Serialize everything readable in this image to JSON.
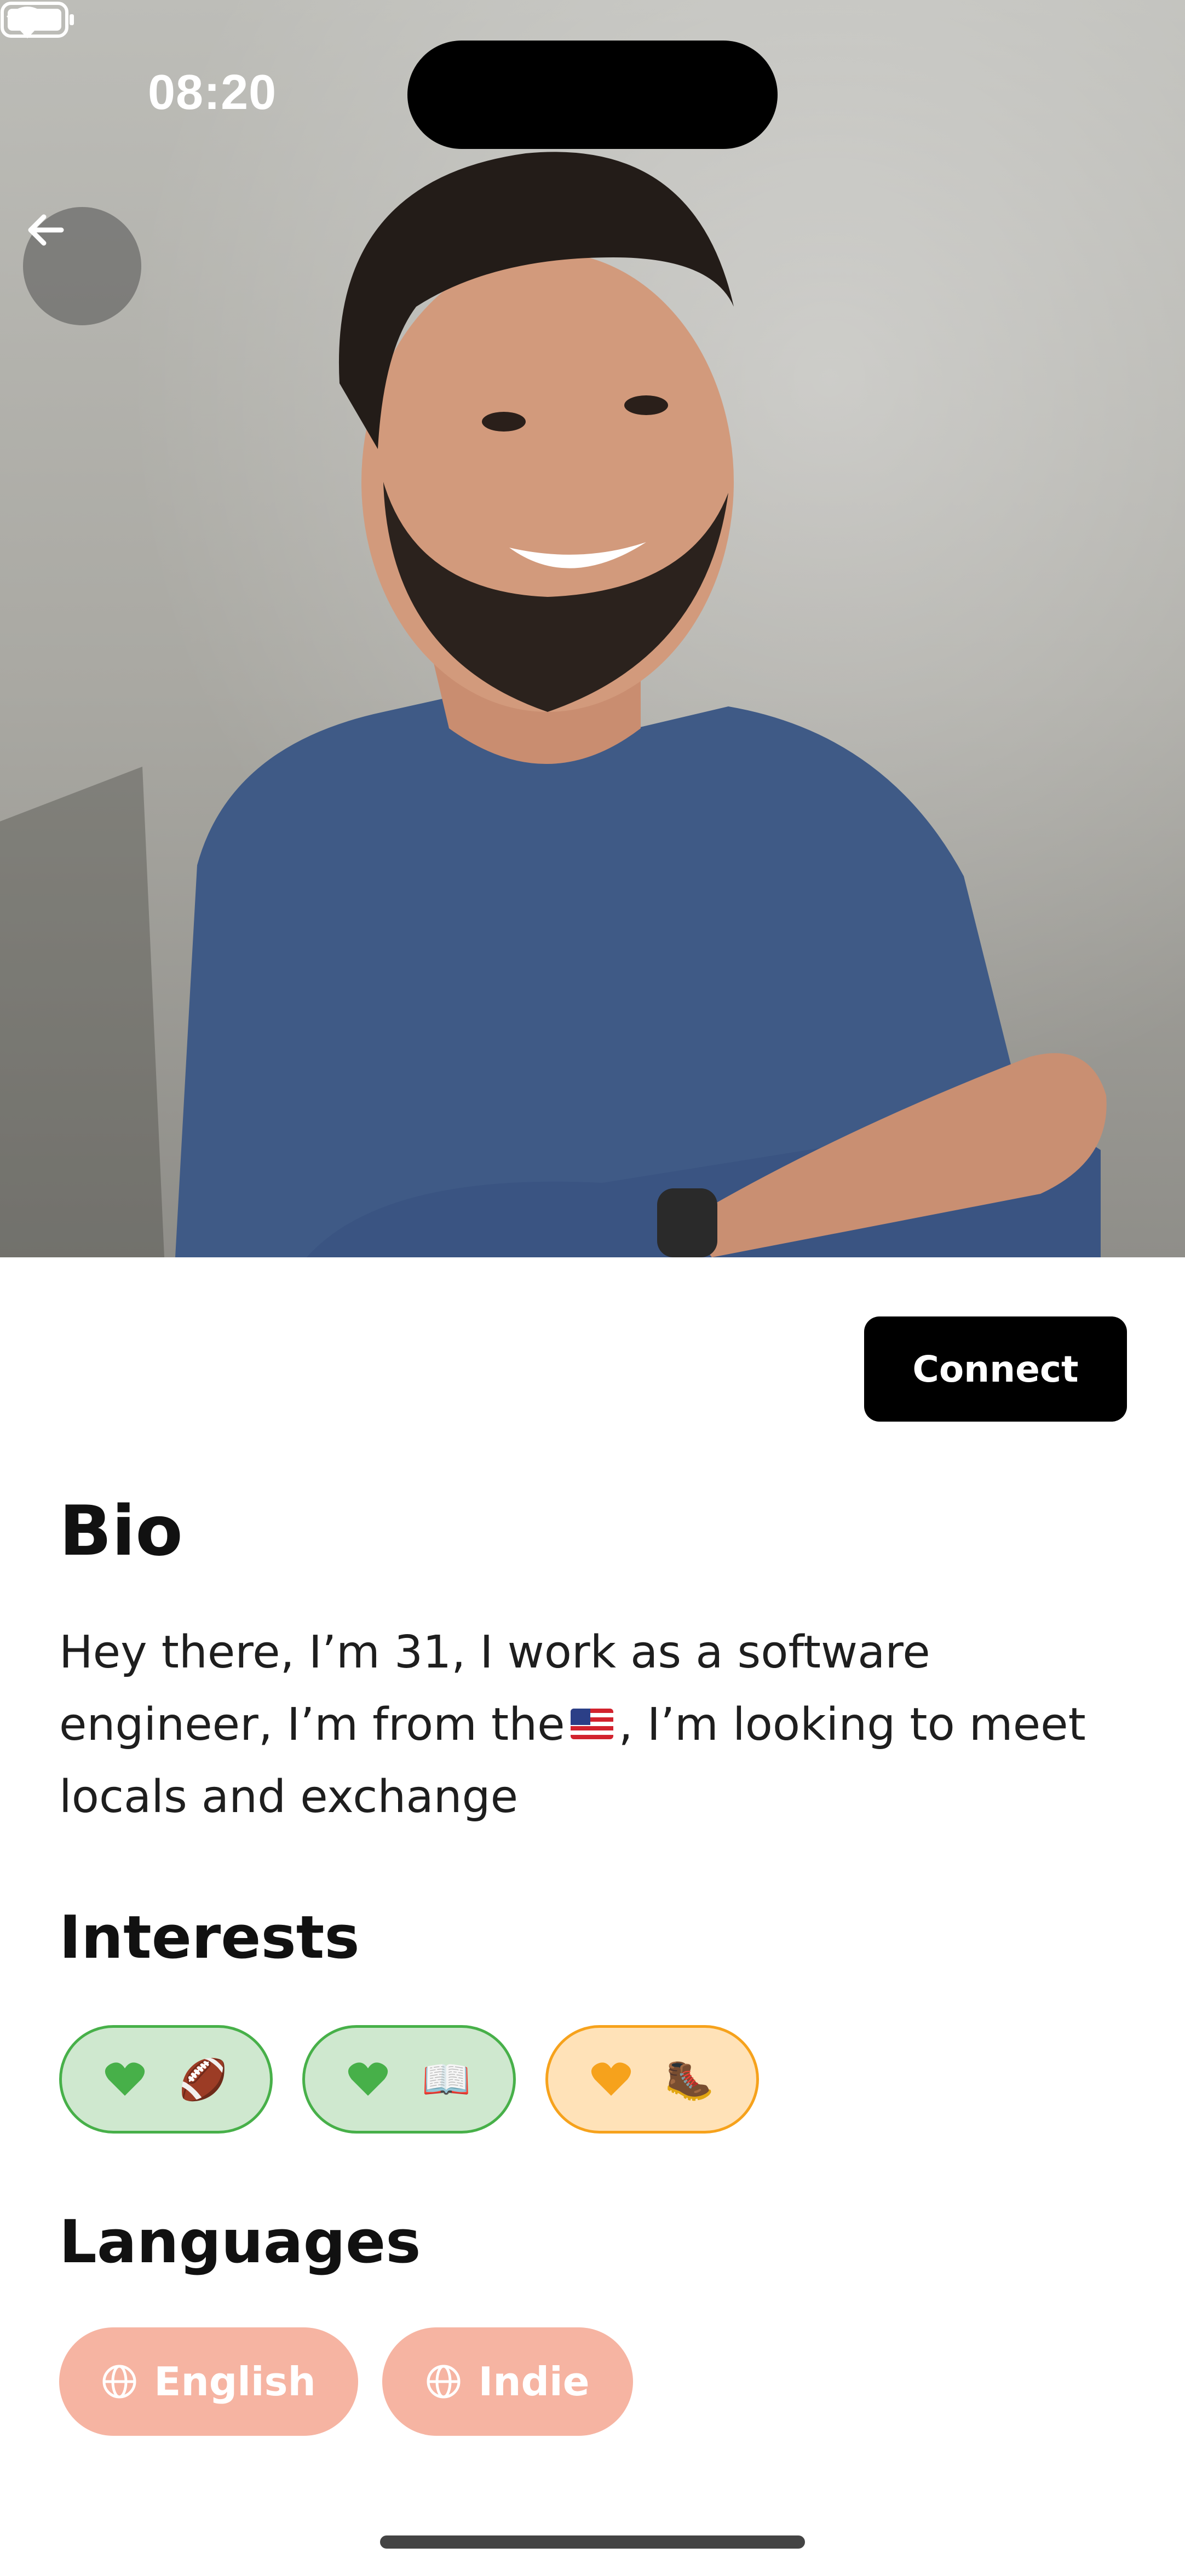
{
  "status_bar": {
    "time": "08:20"
  },
  "profile": {
    "connect_label": "Connect"
  },
  "bio": {
    "title": "Bio",
    "text_before_flag": "Hey there, I’m 31, I work as a software engineer, I’m from the",
    "flag_icon": "us-flag-icon",
    "text_after_flag": ", I’m looking to meet locals and exchange"
  },
  "interests": {
    "title": "Interests",
    "items": [
      {
        "heart_color": "#47b049",
        "emoji": "🏈",
        "style": "green"
      },
      {
        "heart_color": "#47b049",
        "emoji": "📖",
        "style": "green"
      },
      {
        "heart_color": "#f6a21c",
        "emoji": "🥾",
        "style": "orange"
      }
    ]
  },
  "languages": {
    "title": "Languages",
    "items": [
      {
        "label": "English",
        "icon": "globe-icon"
      },
      {
        "label": "Indie",
        "icon": "globe-icon"
      }
    ]
  },
  "colors": {
    "accent_black": "#000000",
    "chip_green_bg": "#cfe8cf",
    "chip_green_border": "#47b049",
    "chip_orange_bg": "#ffe2b8",
    "chip_orange_border": "#f6a21c",
    "language_chip_bg": "#f6b4a2"
  }
}
